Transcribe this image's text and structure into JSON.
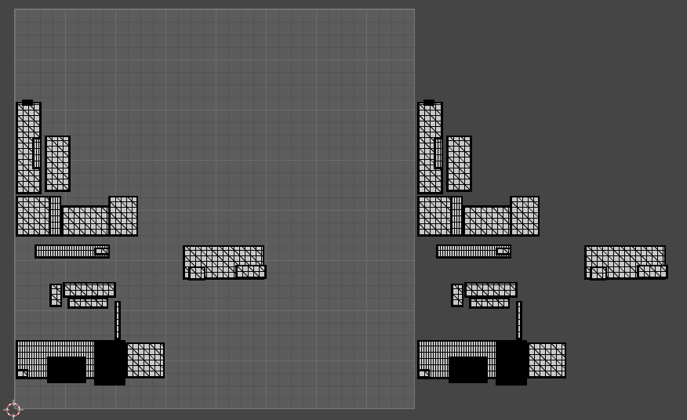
{
  "editor": {
    "name": "UV Editor",
    "background_color": "#454545",
    "tile_color": "#5c5c5c",
    "uv_line_color": "#000000",
    "uv_fill_color": "#c8c8c8"
  },
  "icons": [
    "2d-cursor-icon"
  ]
}
